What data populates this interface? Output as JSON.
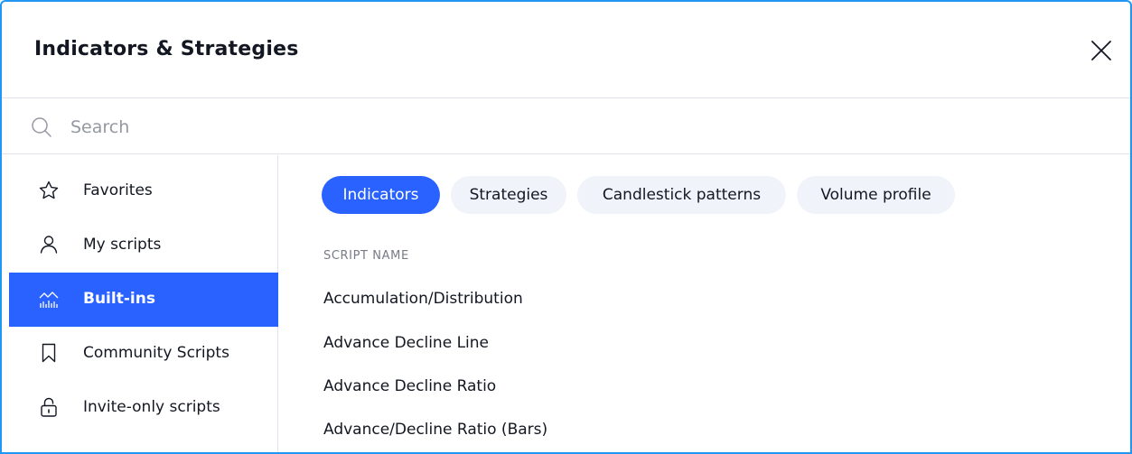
{
  "dialog": {
    "title": "Indicators & Strategies"
  },
  "search": {
    "placeholder": "Search",
    "value": ""
  },
  "sidebar": {
    "items": [
      {
        "label": "Favorites",
        "icon": "star-icon"
      },
      {
        "label": "My scripts",
        "icon": "user-icon"
      },
      {
        "label": "Built-ins",
        "icon": "builtins-chart-icon",
        "active": true
      },
      {
        "label": "Community Scripts",
        "icon": "bookmark-icon"
      },
      {
        "label": "Invite-only scripts",
        "icon": "lock-icon"
      }
    ]
  },
  "tabs": [
    {
      "label": "Indicators",
      "active": true
    },
    {
      "label": "Strategies"
    },
    {
      "label": "Candlestick patterns"
    },
    {
      "label": "Volume profile"
    }
  ],
  "list": {
    "column_header": "SCRIPT NAME",
    "rows": [
      "Accumulation/Distribution",
      "Advance Decline Line",
      "Advance Decline Ratio",
      "Advance/Decline Ratio (Bars)"
    ]
  },
  "colors": {
    "accent": "#2962ff",
    "border": "#2196f3",
    "chip_bg": "#f0f3fa"
  }
}
